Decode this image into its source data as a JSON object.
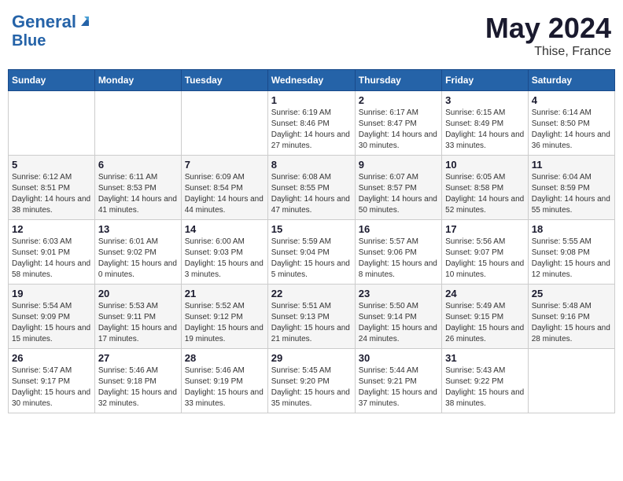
{
  "header": {
    "logo_line1": "General",
    "logo_line2": "Blue",
    "month_year": "May 2024",
    "location": "Thise, France"
  },
  "weekdays": [
    "Sunday",
    "Monday",
    "Tuesday",
    "Wednesday",
    "Thursday",
    "Friday",
    "Saturday"
  ],
  "weeks": [
    [
      {
        "day": "",
        "info": ""
      },
      {
        "day": "",
        "info": ""
      },
      {
        "day": "",
        "info": ""
      },
      {
        "day": "1",
        "info": "Sunrise: 6:19 AM\nSunset: 8:46 PM\nDaylight: 14 hours and 27 minutes."
      },
      {
        "day": "2",
        "info": "Sunrise: 6:17 AM\nSunset: 8:47 PM\nDaylight: 14 hours and 30 minutes."
      },
      {
        "day": "3",
        "info": "Sunrise: 6:15 AM\nSunset: 8:49 PM\nDaylight: 14 hours and 33 minutes."
      },
      {
        "day": "4",
        "info": "Sunrise: 6:14 AM\nSunset: 8:50 PM\nDaylight: 14 hours and 36 minutes."
      }
    ],
    [
      {
        "day": "5",
        "info": "Sunrise: 6:12 AM\nSunset: 8:51 PM\nDaylight: 14 hours and 38 minutes."
      },
      {
        "day": "6",
        "info": "Sunrise: 6:11 AM\nSunset: 8:53 PM\nDaylight: 14 hours and 41 minutes."
      },
      {
        "day": "7",
        "info": "Sunrise: 6:09 AM\nSunset: 8:54 PM\nDaylight: 14 hours and 44 minutes."
      },
      {
        "day": "8",
        "info": "Sunrise: 6:08 AM\nSunset: 8:55 PM\nDaylight: 14 hours and 47 minutes."
      },
      {
        "day": "9",
        "info": "Sunrise: 6:07 AM\nSunset: 8:57 PM\nDaylight: 14 hours and 50 minutes."
      },
      {
        "day": "10",
        "info": "Sunrise: 6:05 AM\nSunset: 8:58 PM\nDaylight: 14 hours and 52 minutes."
      },
      {
        "day": "11",
        "info": "Sunrise: 6:04 AM\nSunset: 8:59 PM\nDaylight: 14 hours and 55 minutes."
      }
    ],
    [
      {
        "day": "12",
        "info": "Sunrise: 6:03 AM\nSunset: 9:01 PM\nDaylight: 14 hours and 58 minutes."
      },
      {
        "day": "13",
        "info": "Sunrise: 6:01 AM\nSunset: 9:02 PM\nDaylight: 15 hours and 0 minutes."
      },
      {
        "day": "14",
        "info": "Sunrise: 6:00 AM\nSunset: 9:03 PM\nDaylight: 15 hours and 3 minutes."
      },
      {
        "day": "15",
        "info": "Sunrise: 5:59 AM\nSunset: 9:04 PM\nDaylight: 15 hours and 5 minutes."
      },
      {
        "day": "16",
        "info": "Sunrise: 5:57 AM\nSunset: 9:06 PM\nDaylight: 15 hours and 8 minutes."
      },
      {
        "day": "17",
        "info": "Sunrise: 5:56 AM\nSunset: 9:07 PM\nDaylight: 15 hours and 10 minutes."
      },
      {
        "day": "18",
        "info": "Sunrise: 5:55 AM\nSunset: 9:08 PM\nDaylight: 15 hours and 12 minutes."
      }
    ],
    [
      {
        "day": "19",
        "info": "Sunrise: 5:54 AM\nSunset: 9:09 PM\nDaylight: 15 hours and 15 minutes."
      },
      {
        "day": "20",
        "info": "Sunrise: 5:53 AM\nSunset: 9:11 PM\nDaylight: 15 hours and 17 minutes."
      },
      {
        "day": "21",
        "info": "Sunrise: 5:52 AM\nSunset: 9:12 PM\nDaylight: 15 hours and 19 minutes."
      },
      {
        "day": "22",
        "info": "Sunrise: 5:51 AM\nSunset: 9:13 PM\nDaylight: 15 hours and 21 minutes."
      },
      {
        "day": "23",
        "info": "Sunrise: 5:50 AM\nSunset: 9:14 PM\nDaylight: 15 hours and 24 minutes."
      },
      {
        "day": "24",
        "info": "Sunrise: 5:49 AM\nSunset: 9:15 PM\nDaylight: 15 hours and 26 minutes."
      },
      {
        "day": "25",
        "info": "Sunrise: 5:48 AM\nSunset: 9:16 PM\nDaylight: 15 hours and 28 minutes."
      }
    ],
    [
      {
        "day": "26",
        "info": "Sunrise: 5:47 AM\nSunset: 9:17 PM\nDaylight: 15 hours and 30 minutes."
      },
      {
        "day": "27",
        "info": "Sunrise: 5:46 AM\nSunset: 9:18 PM\nDaylight: 15 hours and 32 minutes."
      },
      {
        "day": "28",
        "info": "Sunrise: 5:46 AM\nSunset: 9:19 PM\nDaylight: 15 hours and 33 minutes."
      },
      {
        "day": "29",
        "info": "Sunrise: 5:45 AM\nSunset: 9:20 PM\nDaylight: 15 hours and 35 minutes."
      },
      {
        "day": "30",
        "info": "Sunrise: 5:44 AM\nSunset: 9:21 PM\nDaylight: 15 hours and 37 minutes."
      },
      {
        "day": "31",
        "info": "Sunrise: 5:43 AM\nSunset: 9:22 PM\nDaylight: 15 hours and 38 minutes."
      },
      {
        "day": "",
        "info": ""
      }
    ]
  ]
}
